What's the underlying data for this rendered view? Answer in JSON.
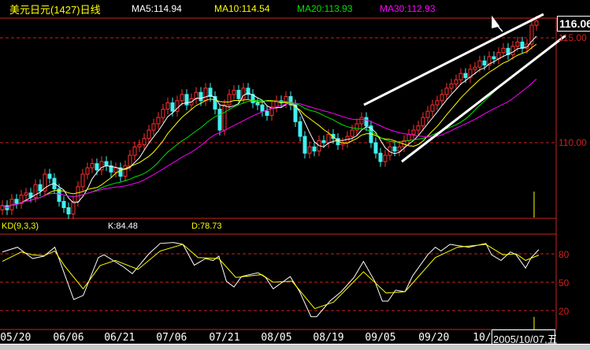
{
  "header": {
    "title": "美元日元(1427)日线",
    "ma5": "MA5:114.94",
    "ma10": "MA10:114.54",
    "ma20": "MA20:113.93",
    "ma30": "MA30:112.93"
  },
  "kd_header": {
    "label": "KD(9,3,3)",
    "k": "K:84.48",
    "d": "D:78.73"
  },
  "price_axis": {
    "current": "116.06",
    "l115": "115.00",
    "l110": "110.00"
  },
  "kd_axis": {
    "l80": "80",
    "l50": "50",
    "l20": "20"
  },
  "cursor_date": "2005/10/07,五",
  "dates": [
    {
      "label": "05/20",
      "i": 2.8
    },
    {
      "label": "06/06",
      "i": 14
    },
    {
      "label": "06/21",
      "i": 24.8
    },
    {
      "label": "07/06",
      "i": 35.8
    },
    {
      "label": "07/21",
      "i": 47
    },
    {
      "label": "08/05",
      "i": 58
    },
    {
      "label": "08/19",
      "i": 69
    },
    {
      "label": "09/05",
      "i": 80
    },
    {
      "label": "09/20",
      "i": 91.3
    },
    {
      "label": "10/",
      "i": 101.5
    }
  ],
  "colors": {
    "up": "#ff3030",
    "down": "#40f0f0",
    "ma5": "#ffffff",
    "ma10": "#ffff00",
    "ma20": "#00e000",
    "ma30": "#ff00ff",
    "grid": "#d02020",
    "k": "#ffffff",
    "d": "#ffff00"
  },
  "chart_data": {
    "type": "candlestick",
    "title": "美元日元(1427)日线",
    "ylim": [
      106.4,
      116.0
    ],
    "close": [
      107.0,
      106.8,
      107.3,
      107.1,
      107.5,
      107.6,
      107.4,
      108.0,
      107.7,
      108.5,
      108.3,
      107.8,
      107.2,
      106.9,
      106.6,
      107.2,
      107.9,
      108.5,
      108.8,
      109.0,
      108.7,
      109.1,
      108.9,
      108.6,
      108.8,
      108.4,
      108.9,
      109.4,
      109.8,
      109.9,
      110.2,
      110.6,
      110.9,
      111.2,
      111.6,
      111.9,
      111.5,
      112.0,
      112.3,
      111.8,
      112.1,
      112.4,
      112.0,
      112.6,
      112.2,
      111.6,
      110.6,
      111.8,
      112.3,
      112.5,
      112.1,
      112.6,
      112.3,
      111.9,
      111.8,
      111.5,
      111.3,
      111.7,
      112.0,
      111.9,
      112.2,
      111.8,
      111.0,
      110.3,
      109.5,
      109.8,
      109.6,
      110.1,
      110.0,
      110.4,
      110.2,
      109.9,
      110.0,
      110.3,
      110.6,
      110.9,
      111.2,
      110.8,
      110.0,
      109.5,
      109.1,
      109.4,
      109.8,
      109.6,
      109.8,
      110.1,
      110.4,
      110.6,
      110.8,
      111.2,
      111.5,
      111.8,
      112.0,
      112.3,
      112.6,
      112.8,
      113.0,
      113.3,
      113.1,
      113.5,
      113.6,
      113.9,
      113.7,
      114.1,
      114.0,
      114.3,
      114.5,
      114.2,
      114.6,
      114.8,
      114.5,
      114.7,
      115.6,
      115.8
    ],
    "ma_periods": [
      5,
      10,
      20,
      30
    ],
    "kd": {
      "ylim": [
        0,
        100
      ],
      "k": [
        [
          0,
          82
        ],
        [
          3.2,
          87
        ],
        [
          6.4,
          75
        ],
        [
          8.8,
          77.5
        ],
        [
          11.1,
          87
        ],
        [
          15.1,
          31.7
        ],
        [
          17.1,
          36
        ],
        [
          20.3,
          76
        ],
        [
          21.5,
          79
        ],
        [
          25.5,
          66.7
        ],
        [
          27.5,
          59
        ],
        [
          31,
          80
        ],
        [
          33.4,
          91
        ],
        [
          36.2,
          92
        ],
        [
          38.2,
          90
        ],
        [
          40.6,
          68
        ],
        [
          43,
          75
        ],
        [
          44.6,
          73
        ],
        [
          45.8,
          77.5
        ],
        [
          47.4,
          51
        ],
        [
          49,
          45
        ],
        [
          50.6,
          56
        ],
        [
          54.1,
          60
        ],
        [
          55.7,
          55
        ],
        [
          57.3,
          43
        ],
        [
          60.9,
          56
        ],
        [
          62.9,
          40
        ],
        [
          65.3,
          13.6
        ],
        [
          66.5,
          13.6
        ],
        [
          69.3,
          30
        ],
        [
          71.7,
          40
        ],
        [
          74.4,
          55
        ],
        [
          76.4,
          72
        ],
        [
          78.8,
          51
        ],
        [
          80.4,
          30
        ],
        [
          81.6,
          30
        ],
        [
          83.2,
          41.7
        ],
        [
          85.2,
          40
        ],
        [
          86.8,
          56.7
        ],
        [
          90,
          79
        ],
        [
          91.6,
          87
        ],
        [
          92.8,
          83
        ],
        [
          94.7,
          90
        ],
        [
          98.7,
          87
        ],
        [
          102.3,
          91
        ],
        [
          103.5,
          79
        ],
        [
          105.5,
          73
        ],
        [
          107.5,
          82
        ],
        [
          108.7,
          79
        ],
        [
          110.7,
          65
        ],
        [
          111.9,
          76
        ],
        [
          113.5,
          84.5
        ]
      ],
      "d": [
        [
          0,
          72
        ],
        [
          4,
          82
        ],
        [
          6.4,
          79
        ],
        [
          8.8,
          78
        ],
        [
          11.1,
          83
        ],
        [
          13.1,
          67.7
        ],
        [
          17.1,
          43
        ],
        [
          20.7,
          67.7
        ],
        [
          23.9,
          73
        ],
        [
          28.7,
          63.6
        ],
        [
          33.4,
          83
        ],
        [
          38.2,
          90
        ],
        [
          41.4,
          76
        ],
        [
          45.8,
          75
        ],
        [
          49.4,
          55
        ],
        [
          54.9,
          58
        ],
        [
          57.3,
          50
        ],
        [
          61.3,
          51
        ],
        [
          66.1,
          22
        ],
        [
          70.1,
          29
        ],
        [
          76.4,
          61
        ],
        [
          81.2,
          38.6
        ],
        [
          85.2,
          40
        ],
        [
          91.6,
          76
        ],
        [
          96.3,
          87
        ],
        [
          102.3,
          90
        ],
        [
          105.9,
          79
        ],
        [
          108.7,
          80
        ],
        [
          110.7,
          73
        ],
        [
          113.5,
          78.7
        ]
      ],
      "levels": [
        80,
        50,
        20
      ]
    }
  }
}
